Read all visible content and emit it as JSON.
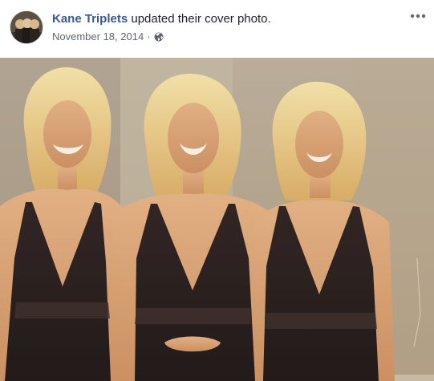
{
  "post": {
    "author": "Kane Triplets",
    "action": "updated their cover photo.",
    "date": "November 18, 2014",
    "separator": "·",
    "audience_icon": "globe-icon",
    "more_icon": "more-options-icon"
  },
  "photo": {
    "subject_icon": "photo-three-women-in-black-dresses"
  },
  "colors": {
    "author_link": "#385898",
    "meta_text": "#616770",
    "title_text": "#1d2129"
  }
}
